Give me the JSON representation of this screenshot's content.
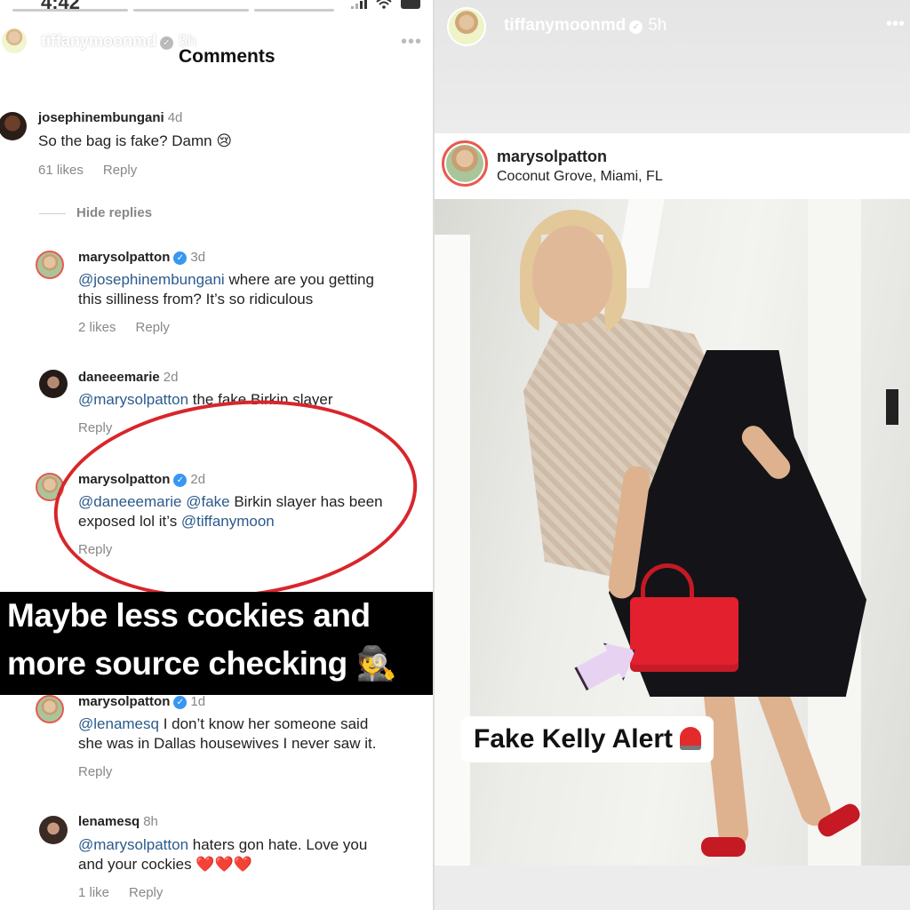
{
  "left_story": {
    "status_time": "4:42",
    "story_username": "tiffanymoonmd",
    "story_age": "5h",
    "panel_title": "Comments",
    "comments": [
      {
        "username": "josephinembungani",
        "age": "4d",
        "text": "So the bag is fake? Damn 😢",
        "likes": "61 likes",
        "reply": "Reply"
      }
    ],
    "hide_replies": "Hide replies",
    "replies": [
      {
        "username": "marysolpatton",
        "age": "3d",
        "mention": "@josephinembungani",
        "text_line1": " where are you getting",
        "text_line2": "this silliness from? It’s so ridiculous",
        "likes": "2 likes",
        "reply": "Reply"
      },
      {
        "username": "daneeemarie",
        "age": "2d",
        "mention": "@marysolpatton",
        "text_line1": " the fake Birkin slayer",
        "reply": "Reply"
      },
      {
        "username": "marysolpatton",
        "age": "2d",
        "mention1": "@daneeemarie",
        "mention2": "@fake",
        "text_line1": " Birkin slayer has been",
        "text_line2_prefix": "exposed lol it’s ",
        "mention3": "@tiffanymoon",
        "reply": "Reply"
      },
      {
        "username": "marysolpatton",
        "age": "1d",
        "mention": "@lenamesq",
        "text_line1": " I don’t know her someone said",
        "text_line2": "she was in Dallas housewives I never saw it.",
        "reply": "Reply"
      },
      {
        "username": "lenamesq",
        "age": "8h",
        "mention": "@marysolpatton",
        "text_line1": " haters gon hate. Love you",
        "text_line2": "and your cockies ❤️❤️❤️",
        "likes": "1 like",
        "reply": "Reply"
      }
    ],
    "banner_line1": "Maybe less cockies and",
    "banner_line2": "more source checking 🕵️"
  },
  "right_story": {
    "story_username": "tiffanymoonmd",
    "story_age": "5h",
    "post_username": "marysolpatton",
    "post_location": "Coconut Grove, Miami, FL",
    "sticker_text": "Fake Kelly Alert"
  },
  "icons": {
    "verified": "verified-badge-icon",
    "more": "more-options-icon",
    "siren": "siren-icon",
    "arrow": "arrow-sticker-icon"
  },
  "colors": {
    "mention_blue": "#2b5a8c",
    "verified_blue": "#3897f0",
    "annotation_red": "#d8262b",
    "banner_black": "#000000",
    "bag_red": "#e3202e"
  }
}
